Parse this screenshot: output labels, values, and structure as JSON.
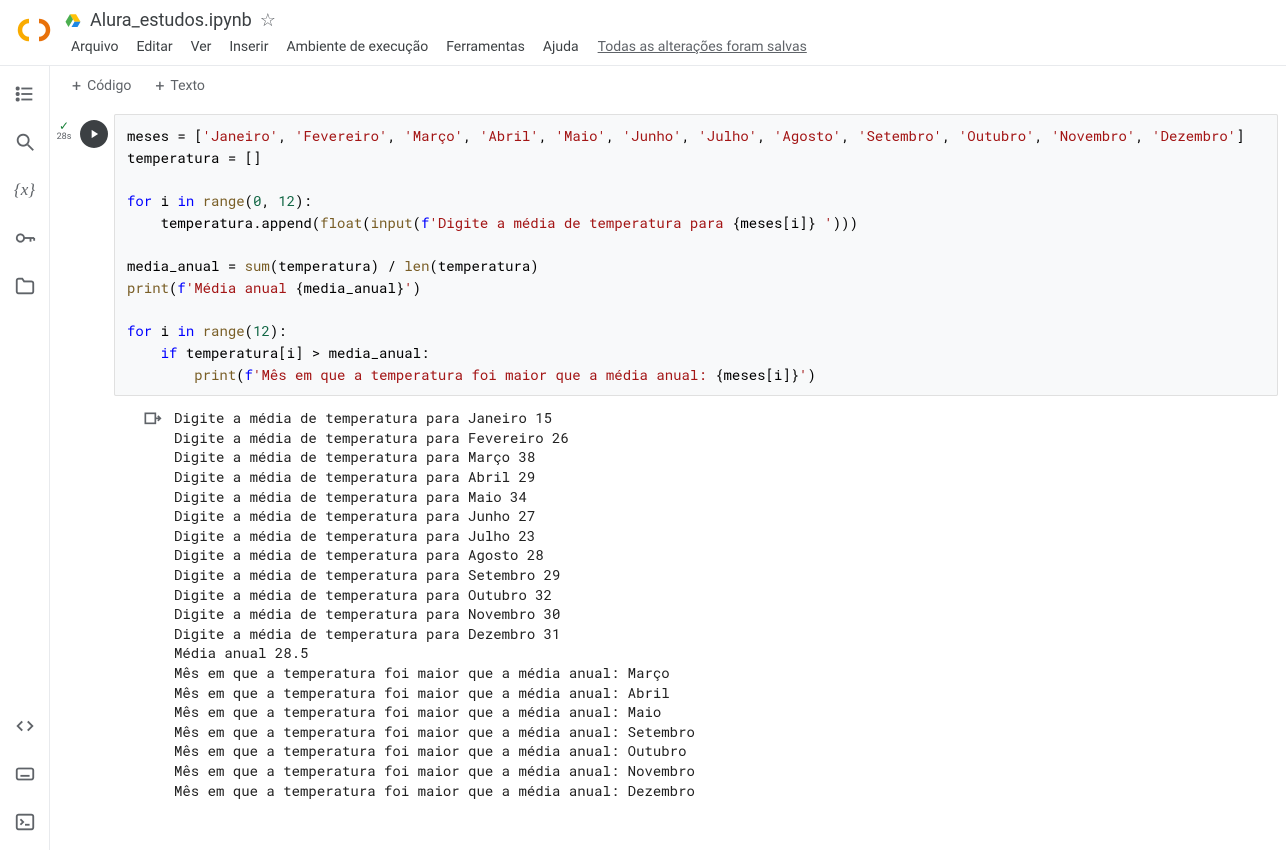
{
  "header": {
    "title": "Alura_estudos.ipynb",
    "menus": [
      "Arquivo",
      "Editar",
      "Ver",
      "Inserir",
      "Ambiente de execução",
      "Ferramentas",
      "Ajuda"
    ],
    "save_status": "Todas as alterações foram salvas"
  },
  "toolbar": {
    "code_label": "Código",
    "text_label": "Texto"
  },
  "cell": {
    "exec_time": "28s",
    "code_meses_assign": "meses = [",
    "code_meses_list": [
      "'Janeiro'",
      "'Fevereiro'",
      "'Março'",
      "'Abril'",
      "'Maio'",
      "'Junho'",
      "'Julho'",
      "'Agosto'",
      "'Setembro'",
      "'Outubro'",
      "'Novembro'",
      "'Dezembro'"
    ],
    "code_temp_assign": "temperatura = []",
    "code_for1": "for i in range(0, 12):",
    "code_append_pre": "    temperatura.append(float(input(",
    "code_append_str": "f'Digite a média de temperatura para {meses[i]} '",
    "code_append_post": ")))",
    "code_media": "media_anual = sum(temperatura) / len(temperatura)",
    "code_print1_pre": "print(",
    "code_print1_str": "f'Média anual {media_anual}'",
    "code_print1_post": ")",
    "code_for2": "for i in range(12):",
    "code_if": "    if temperatura[i] > media_anual:",
    "code_print2_pre": "        print(",
    "code_print2_str": "f'Mês em que a temperatura foi maior que a média anual: {meses[i]}'",
    "code_print2_post": ")"
  },
  "output_lines": [
    "Digite a média de temperatura para Janeiro 15",
    "Digite a média de temperatura para Fevereiro 26",
    "Digite a média de temperatura para Março 38",
    "Digite a média de temperatura para Abril 29",
    "Digite a média de temperatura para Maio 34",
    "Digite a média de temperatura para Junho 27",
    "Digite a média de temperatura para Julho 23",
    "Digite a média de temperatura para Agosto 28",
    "Digite a média de temperatura para Setembro 29",
    "Digite a média de temperatura para Outubro 32",
    "Digite a média de temperatura para Novembro 30",
    "Digite a média de temperatura para Dezembro 31",
    "Média anual 28.5",
    "Mês em que a temperatura foi maior que a média anual: Março",
    "Mês em que a temperatura foi maior que a média anual: Abril",
    "Mês em que a temperatura foi maior que a média anual: Maio",
    "Mês em que a temperatura foi maior que a média anual: Setembro",
    "Mês em que a temperatura foi maior que a média anual: Outubro",
    "Mês em que a temperatura foi maior que a média anual: Novembro",
    "Mês em que a temperatura foi maior que a média anual: Dezembro"
  ]
}
